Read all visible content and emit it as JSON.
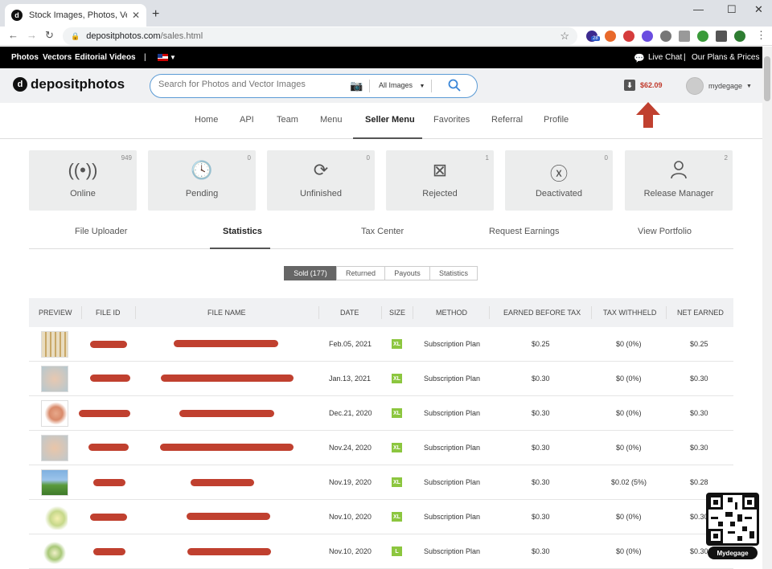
{
  "browser": {
    "tab_title": "Stock Images, Photos, Vectors, Il",
    "tab_close": "✕",
    "new_tab": "+",
    "url_host": "depositphotos.com",
    "url_path": "/sales.html",
    "ext_badge": "28"
  },
  "topbar": {
    "links": [
      "Photos",
      "Vectors",
      "Editorial",
      "Videos"
    ],
    "divider": "|",
    "live_chat": "Live Chat",
    "plans": "Our Plans & Prices"
  },
  "header": {
    "logo": "depositphotos",
    "search_placeholder": "Search for Photos and Vector Images",
    "search_filter": "All Images",
    "balance": "$62.09",
    "username": "mydegage"
  },
  "menu": {
    "items": [
      "Home",
      "API",
      "Team",
      "Menu",
      "Seller Menu",
      "Favorites",
      "Referral",
      "Profile"
    ],
    "active": "Seller Menu"
  },
  "status_boxes": [
    {
      "label": "Online",
      "count": "949",
      "icon": "broadcast-icon"
    },
    {
      "label": "Pending",
      "count": "0",
      "icon": "clock-icon"
    },
    {
      "label": "Unfinished",
      "count": "0",
      "icon": "refresh-pause-icon"
    },
    {
      "label": "Rejected",
      "count": "1",
      "icon": "crossed-image-icon"
    },
    {
      "label": "Deactivated",
      "count": "0",
      "icon": "x-circle-icon"
    },
    {
      "label": "Release Manager",
      "count": "2",
      "icon": "person-icon"
    }
  ],
  "sub_tabs": {
    "items": [
      "File Uploader",
      "Statistics",
      "Tax Center",
      "Request Earnings",
      "View Portfolio"
    ],
    "active": "Statistics"
  },
  "toggle": {
    "items": [
      "Sold (177)",
      "Returned",
      "Payouts",
      "Statistics"
    ],
    "active": "Sold (177)"
  },
  "table": {
    "headers": [
      "PREVIEW",
      "FILE ID",
      "FILE NAME",
      "DATE",
      "SIZE",
      "METHOD",
      "EARNED BEFORE TAX",
      "TAX WITHHELD",
      "NET EARNED"
    ],
    "rows": [
      {
        "date": "Feb.05, 2021",
        "size": "XL",
        "method": "Subscription Plan",
        "earned": "$0.25",
        "tax": "$0 (0%)",
        "net": "$0.25"
      },
      {
        "date": "Jan.13, 2021",
        "size": "XL",
        "method": "Subscription Plan",
        "earned": "$0.30",
        "tax": "$0 (0%)",
        "net": "$0.30"
      },
      {
        "date": "Dec.21, 2020",
        "size": "XL",
        "method": "Subscription Plan",
        "earned": "$0.30",
        "tax": "$0 (0%)",
        "net": "$0.30"
      },
      {
        "date": "Nov.24, 2020",
        "size": "XL",
        "method": "Subscription Plan",
        "earned": "$0.30",
        "tax": "$0 (0%)",
        "net": "$0.30"
      },
      {
        "date": "Nov.19, 2020",
        "size": "XL",
        "method": "Subscription Plan",
        "earned": "$0.30",
        "tax": "$0.02 (5%)",
        "net": "$0.28"
      },
      {
        "date": "Nov.10, 2020",
        "size": "XL",
        "method": "Subscription Plan",
        "earned": "$0.30",
        "tax": "$0 (0%)",
        "net": "$0.30"
      },
      {
        "date": "Nov.10, 2020",
        "size": "L",
        "method": "Subscription Plan",
        "earned": "$0.30",
        "tax": "$0 (0%)",
        "net": "$0.30"
      }
    ]
  },
  "watermark": {
    "label": "Mydegage"
  },
  "colors": {
    "accent": "#3a86d8",
    "redaction": "#c0402f",
    "size_badge": "#8cc63f",
    "balance": "#c0392b"
  }
}
